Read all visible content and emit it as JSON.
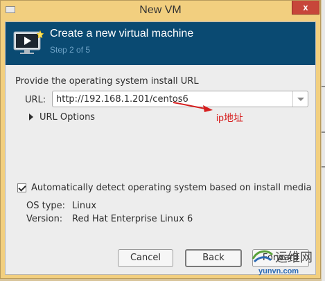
{
  "window": {
    "title": "New VM",
    "close_label": "x"
  },
  "header": {
    "title": "Create a new virtual machine",
    "step": "Step 2 of 5",
    "icon": "monitor-play-icon"
  },
  "form": {
    "prompt": "Provide the operating system install URL",
    "url_label": "URL:",
    "url_value": "http://192.168.1.201/centos6",
    "url_options_label": "URL Options",
    "auto_detect_label": "Automatically detect operating system based on install media",
    "auto_detect_checked": true,
    "os_type_label": "OS type:",
    "os_type_value": "Linux",
    "version_label": "Version:",
    "version_value": "Red Hat Enterprise Linux 6"
  },
  "annotation": {
    "text": "ip地址",
    "color": "#d61f1f"
  },
  "buttons": {
    "cancel": "Cancel",
    "back": "Back",
    "forward": "Forward"
  },
  "watermark": {
    "text": "运维网",
    "domain": "yunvn.com"
  },
  "colors": {
    "titlebar": "#f2cf7f",
    "header": "#0a4a72",
    "close": "#c7463a"
  }
}
